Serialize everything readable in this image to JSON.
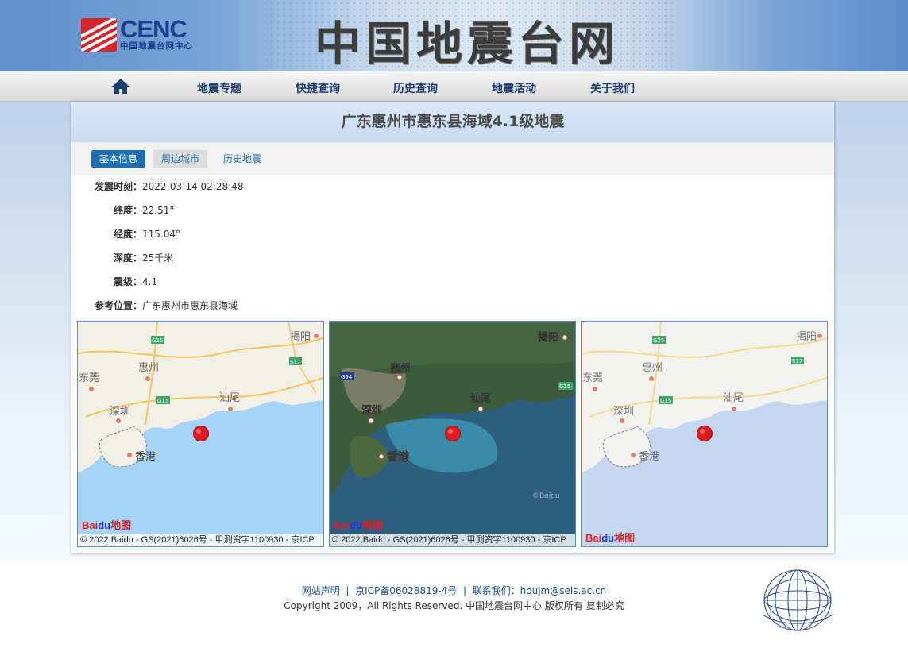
{
  "header": {
    "logo_text": "CENC",
    "logo_subtext": "中国地震台网中心",
    "site_title": "中国地震台网"
  },
  "nav": {
    "home_icon": "home-icon",
    "items": [
      "地震专题",
      "快捷查询",
      "历史查询",
      "地震活动",
      "关于我们"
    ]
  },
  "event": {
    "title": "广东惠州市惠东县海域4.1级地震",
    "tabs": [
      "基本信息",
      "周边城市",
      "历史地震"
    ],
    "fields": [
      {
        "label": "发震时刻：",
        "value": "2022-03-14 02:28:48"
      },
      {
        "label": "纬度：",
        "value": "22.51°"
      },
      {
        "label": "经度：",
        "value": "115.04°"
      },
      {
        "label": "深度：",
        "value": "25千米"
      },
      {
        "label": "震级：",
        "value": "4.1"
      },
      {
        "label": "参考位置：",
        "value": "广东惠州市惠东县海域"
      }
    ]
  },
  "maps": {
    "labels": {
      "dongguan": "东莞",
      "huizhou": "惠州",
      "shenzhen": "深圳",
      "shanwei": "汕尾",
      "hongkong": "香港",
      "jieyang": "揭阳",
      "g25": "G25",
      "g15": "G15",
      "g94": "G94",
      "s17": "S17",
      "watermark": "©Baidu"
    },
    "baidu_logo": "Bai",
    "baidu_logo_du": "du",
    "baidu_logo_tail": "地图",
    "copyright": "© 2022 Baidu - GS(2021)6026号 - 甲测资字1100930 - 京ICP"
  },
  "footer": {
    "link1": "网站声明",
    "sep": "|",
    "link2": "京ICP备06028819-4号",
    "link3": "联系我们：houjm@seis.ac.cn",
    "copyright": "Copyright 2009，All Rights Reserved. 中国地震台网中心 版权所有 复制必究"
  },
  "colors": {
    "accent": "#1c6fb0",
    "nav_text": "#1c3c6f",
    "epicenter": "#e01b1b",
    "sea_map": "#a7d3f7",
    "sea_grey": "#c3d7f1"
  }
}
